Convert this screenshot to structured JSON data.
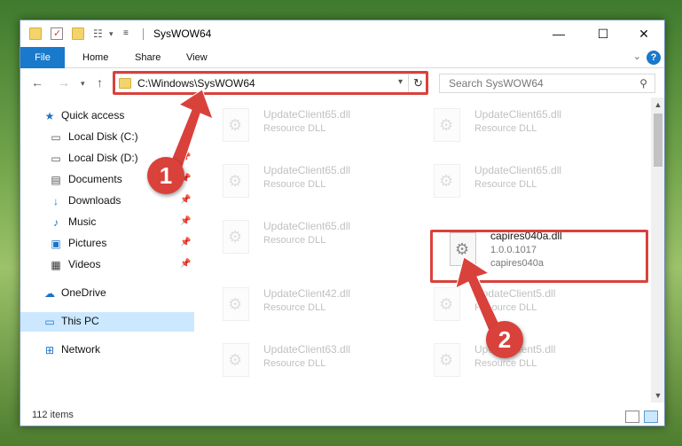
{
  "window": {
    "title": "SysWOW64",
    "controls": {
      "minimize": "—",
      "maximize": "☐",
      "close": "✕"
    }
  },
  "ribbon": {
    "file_tab": "File",
    "tabs": [
      "Home",
      "Share",
      "View"
    ],
    "help": "?"
  },
  "navigation": {
    "address": "C:\\Windows\\SysWOW64",
    "search_placeholder": "Search SysWOW64"
  },
  "sidebar": {
    "items": [
      {
        "label": "Quick access",
        "icon": "star-icon",
        "pinned": false
      },
      {
        "label": "Local Disk (C:)",
        "icon": "drive-icon",
        "pinned": false
      },
      {
        "label": "Local Disk (D:)",
        "icon": "drive-icon",
        "pinned": true
      },
      {
        "label": "Documents",
        "icon": "documents-icon",
        "pinned": true
      },
      {
        "label": "Downloads",
        "icon": "download-icon",
        "pinned": true
      },
      {
        "label": "Music",
        "icon": "music-icon",
        "pinned": true
      },
      {
        "label": "Pictures",
        "icon": "pictures-icon",
        "pinned": true
      },
      {
        "label": "Videos",
        "icon": "videos-icon",
        "pinned": true
      },
      {
        "label": "OneDrive",
        "icon": "cloud-icon",
        "pinned": false
      },
      {
        "label": "This PC",
        "icon": "computer-icon",
        "pinned": false,
        "selected": true
      },
      {
        "label": "Network",
        "icon": "network-icon",
        "pinned": false
      }
    ]
  },
  "files": [
    {
      "name": "UpdateClient65.dll",
      "sub": "Resource DLL",
      "faded": true
    },
    {
      "name": "UpdateClient65.dll",
      "sub": "Resource DLL",
      "faded": true
    },
    {
      "name": "UpdateClient65.dll",
      "sub": "Resource DLL",
      "faded": true
    },
    {
      "name": "UpdateClient65.dll",
      "sub": "Resource DLL",
      "faded": true
    },
    {
      "name": "UpdateClient65.dll",
      "sub": "Resource DLL",
      "faded": true
    },
    {
      "name": "capires040a.dll",
      "version": "1.0.0.1017",
      "sub": "capires040a",
      "faded": false,
      "highlighted": true
    },
    {
      "name": "UpdateClient42.dll",
      "sub": "Resource DLL",
      "faded": true
    },
    {
      "name": "UpdateClient5.dll",
      "sub": "Resource DLL",
      "faded": true
    },
    {
      "name": "UpdateClient63.dll",
      "sub": "Resource DLL",
      "faded": true
    },
    {
      "name": "UpdateClient5.dll",
      "sub": "Resource DLL",
      "faded": true
    }
  ],
  "status": {
    "item_count": "112 items"
  },
  "annotations": {
    "step1": "1",
    "step2": "2",
    "color": "#d9413b"
  }
}
